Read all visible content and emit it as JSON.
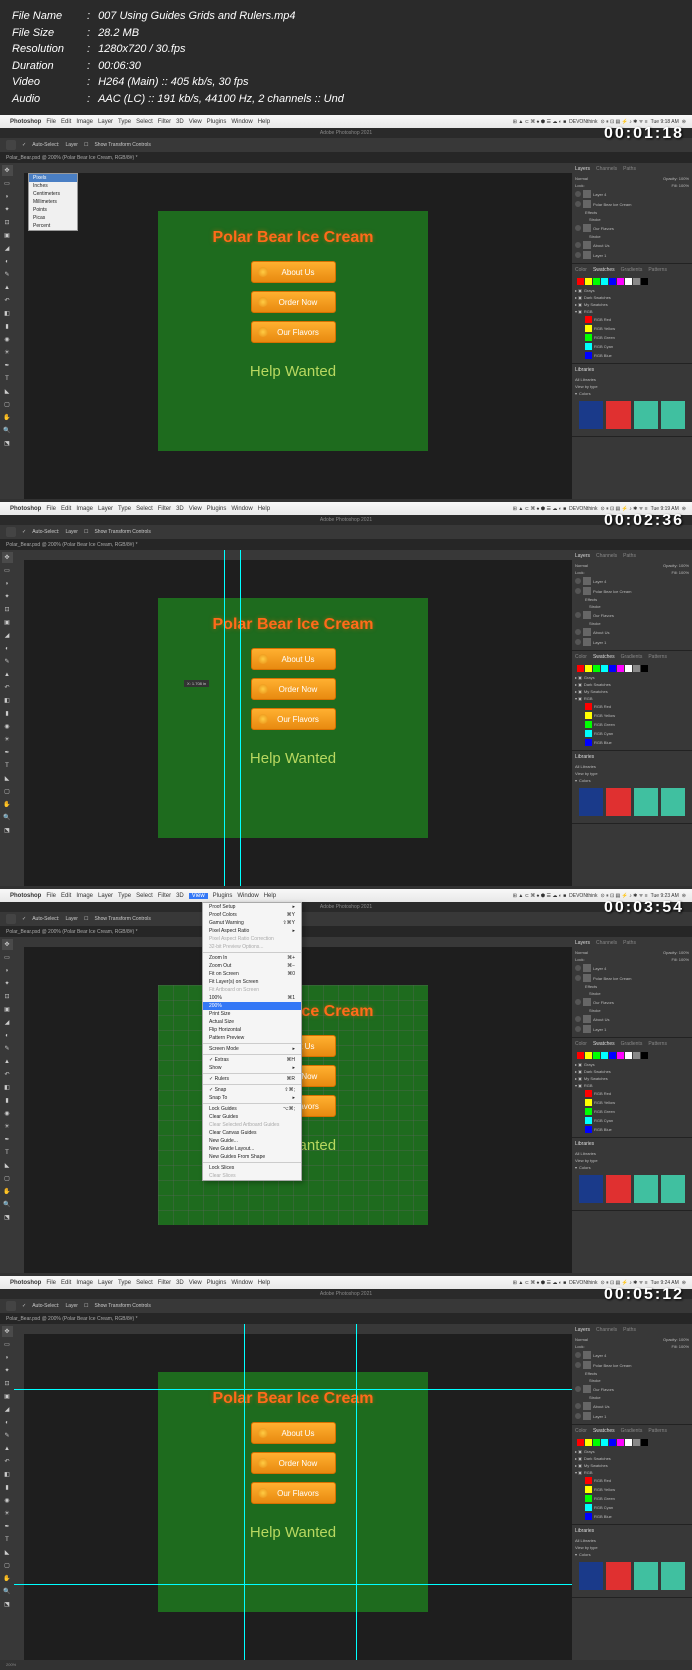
{
  "file_info": {
    "name_label": "File Name",
    "name": "007 Using Guides Grids and Rulers.mp4",
    "size_label": "File Size",
    "size": "28.2 MB",
    "res_label": "Resolution",
    "res": "1280x720 / 30.fps",
    "dur_label": "Duration",
    "dur": "00:06:30",
    "vid_label": "Video",
    "vid": "H264 (Main) :: 405 kb/s, 30 fps",
    "aud_label": "Audio",
    "aud": "AAC (LC) :: 191 kb/s, 44100 Hz, 2 channels :: Und"
  },
  "timestamps": [
    "00:01:18",
    "00:02:36",
    "00:03:54",
    "00:05:12"
  ],
  "mac_menu": {
    "app": "Photoshop",
    "items": [
      "File",
      "Edit",
      "Image",
      "Layer",
      "Type",
      "Select",
      "Filter",
      "3D",
      "View",
      "Plugins",
      "Window",
      "Help"
    ],
    "time": [
      "Tue 9:18 AM",
      "Tue 9:19 AM",
      "Tue 9:23 AM",
      "Tue 9:24 AM"
    ],
    "devonthink": "DEVONthink"
  },
  "ps": {
    "titlebar": "Adobe Photoshop 2021",
    "options": {
      "auto_select": "Auto-Select:",
      "layer": "Layer",
      "show": "Show Transform Controls"
    },
    "tab": "Polar_Bear.psd @ 200% (Polar Bear Ice Cream, RGB/8#) *",
    "status": "200%"
  },
  "canvas": {
    "title": "Polar Bear Ice Cream",
    "btn1": "About Us",
    "btn2": "Order Now",
    "btn3": "Our Flavors",
    "footer": "Help Wanted"
  },
  "ruler_menu": [
    "Pixels",
    "Inches",
    "Centimeters",
    "Millimeters",
    "Points",
    "Picas",
    "Percent"
  ],
  "guide_label": "X: 1.708 in",
  "view_menu": {
    "items": [
      {
        "l": "Proof Setup",
        "s": "▸"
      },
      {
        "l": "Proof Colors",
        "s": "⌘Y"
      },
      {
        "l": "Gamut Warning",
        "s": "⇧⌘Y"
      },
      {
        "l": "Pixel Aspect Ratio",
        "s": "▸"
      },
      {
        "l": "Pixel Aspect Ratio Correction",
        "d": true
      },
      {
        "l": "32-bit Preview Options...",
        "d": true
      },
      {
        "sep": true
      },
      {
        "l": "Zoom In",
        "s": "⌘+"
      },
      {
        "l": "Zoom Out",
        "s": "⌘−"
      },
      {
        "l": "Fit on Screen",
        "s": "⌘0"
      },
      {
        "l": "Fit Layer(s) on Screen"
      },
      {
        "l": "Fit Artboard on Screen",
        "d": true
      },
      {
        "l": "100%",
        "s": "⌘1"
      },
      {
        "l": "200%",
        "hl": true
      },
      {
        "l": "Print Size"
      },
      {
        "l": "Actual Size"
      },
      {
        "l": "Flip Horizontal"
      },
      {
        "l": "Pattern Preview"
      },
      {
        "sep": true
      },
      {
        "l": "Screen Mode",
        "s": "▸"
      },
      {
        "sep": true
      },
      {
        "l": "✓ Extras",
        "s": "⌘H"
      },
      {
        "l": "Show",
        "s": "▸"
      },
      {
        "sep": true
      },
      {
        "l": "✓ Rulers",
        "s": "⌘R"
      },
      {
        "sep": true
      },
      {
        "l": "✓ Snap",
        "s": "⇧⌘;"
      },
      {
        "l": "Snap To",
        "s": "▸"
      },
      {
        "sep": true
      },
      {
        "l": "Lock Guides",
        "s": "⌥⌘;"
      },
      {
        "l": "Clear Guides"
      },
      {
        "l": "Clear Selected Artboard Guides",
        "d": true
      },
      {
        "l": "Clear Canvas Guides"
      },
      {
        "l": "New Guide..."
      },
      {
        "l": "New Guide Layout..."
      },
      {
        "l": "New Guides From Shape"
      },
      {
        "sep": true
      },
      {
        "l": "Lock Slices"
      },
      {
        "l": "Clear Slices",
        "d": true
      }
    ]
  },
  "panels": {
    "layers_tabs": [
      "Layers",
      "Channels",
      "Paths"
    ],
    "layers": [
      "Layer 4",
      "Polar Bear Ice Cream",
      "Effects",
      "Stroke",
      "Our Flavors",
      "Stroke",
      "About Us",
      "Layer 1"
    ],
    "blend": "Normal",
    "opacity": "Opacity: 100%",
    "fill": "Fill: 100%",
    "lock": "Lock:",
    "swatches_tabs": [
      "Color",
      "Swatches",
      "Gradients",
      "Patterns"
    ],
    "swatch_groups": [
      "Grays",
      "Dark Swatches",
      "My Swatches",
      "RGB",
      "RGB Red",
      "RGB Yellow",
      "RGB Green",
      "RGB Cyan",
      "RGB Blue"
    ],
    "lib_label": "Libraries",
    "lib_search": "All Libraries",
    "view_by": "View by type",
    "colors_label": "Colors"
  },
  "lib_colors": [
    "#1a3a8a",
    "#e03030",
    "#40c0a0",
    "#40c0a0"
  ]
}
